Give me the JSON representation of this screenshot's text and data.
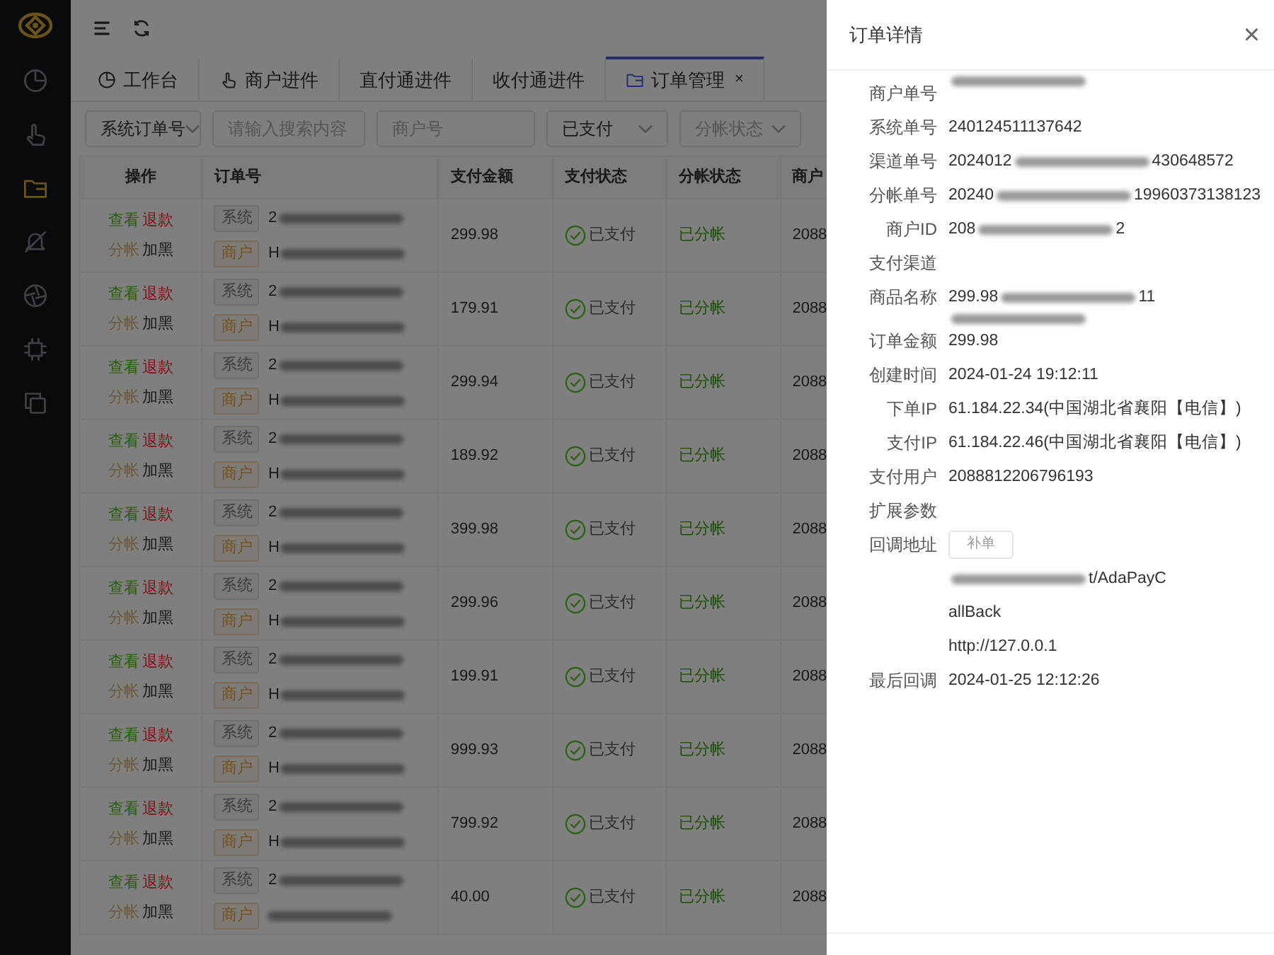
{
  "sidebar": {
    "items": [
      {
        "selected": false
      },
      {
        "selected": false
      },
      {
        "selected": true
      },
      {
        "selected": false
      },
      {
        "selected": false
      },
      {
        "selected": false
      },
      {
        "selected": false
      }
    ]
  },
  "tabs": [
    {
      "label": "工作台",
      "selected": false
    },
    {
      "label": "商户进件",
      "selected": false
    },
    {
      "label": "直付通进件",
      "selected": false
    },
    {
      "label": "收付通进件",
      "selected": false
    },
    {
      "label": "订单管理",
      "selected": true,
      "close": "×"
    }
  ],
  "filters": [
    {
      "kind": "select",
      "value": "系统订单号"
    },
    {
      "kind": "input",
      "placeholder": "请输入搜索内容"
    },
    {
      "kind": "input",
      "placeholder": "商户号"
    },
    {
      "kind": "select",
      "value": "已支付"
    },
    {
      "kind": "select",
      "placeholder": "分帐状态"
    }
  ],
  "table": {
    "columns": [
      "操作",
      "订单号",
      "支付金额",
      "支付状态",
      "分帐状态",
      "商户"
    ],
    "rows": [
      {
        "actions": [
          {
            "kind": "view",
            "label": "查看"
          },
          {
            "kind": "refund",
            "label": "退款"
          },
          {
            "kind": "split",
            "label": "分帐"
          },
          {
            "kind": "block",
            "label": "加黑"
          }
        ],
        "sys_tag": "系统",
        "sys_prefix": "2",
        "mer_tag": "商户",
        "mer_prefix": "H",
        "amount": "299.98",
        "pay_status": "已支付",
        "split_status": "已分帐",
        "merchant": "2088"
      },
      {
        "actions": [
          {
            "kind": "view",
            "label": "查看"
          },
          {
            "kind": "refund",
            "label": "退款"
          },
          {
            "kind": "split",
            "label": "分帐"
          },
          {
            "kind": "block",
            "label": "加黑"
          }
        ],
        "sys_tag": "系统",
        "sys_prefix": "2",
        "mer_tag": "商户",
        "mer_prefix": "H",
        "amount": "179.91",
        "pay_status": "已支付",
        "split_status": "已分帐",
        "merchant": "2088"
      },
      {
        "actions": [
          {
            "kind": "view",
            "label": "查看"
          },
          {
            "kind": "refund",
            "label": "退款"
          },
          {
            "kind": "split",
            "label": "分帐"
          },
          {
            "kind": "block",
            "label": "加黑"
          }
        ],
        "sys_tag": "系统",
        "sys_prefix": "2",
        "mer_tag": "商户",
        "mer_prefix": "H",
        "amount": "299.94",
        "pay_status": "已支付",
        "split_status": "已分帐",
        "merchant": "2088"
      },
      {
        "actions": [
          {
            "kind": "view",
            "label": "查看"
          },
          {
            "kind": "refund",
            "label": "退款"
          },
          {
            "kind": "split",
            "label": "分帐"
          },
          {
            "kind": "block",
            "label": "加黑"
          }
        ],
        "sys_tag": "系统",
        "sys_prefix": "2",
        "mer_tag": "商户",
        "mer_prefix": "H",
        "amount": "189.92",
        "pay_status": "已支付",
        "split_status": "已分帐",
        "merchant": "2088"
      },
      {
        "actions": [
          {
            "kind": "view",
            "label": "查看"
          },
          {
            "kind": "refund",
            "label": "退款"
          },
          {
            "kind": "split",
            "label": "分帐"
          },
          {
            "kind": "block",
            "label": "加黑"
          }
        ],
        "sys_tag": "系统",
        "sys_prefix": "2",
        "mer_tag": "商户",
        "mer_prefix": "H",
        "amount": "399.98",
        "pay_status": "已支付",
        "split_status": "已分帐",
        "merchant": "2088"
      },
      {
        "actions": [
          {
            "kind": "view",
            "label": "查看"
          },
          {
            "kind": "refund",
            "label": "退款"
          },
          {
            "kind": "split",
            "label": "分帐"
          },
          {
            "kind": "block",
            "label": "加黑"
          }
        ],
        "sys_tag": "系统",
        "sys_prefix": "2",
        "mer_tag": "商户",
        "mer_prefix": "H",
        "amount": "299.96",
        "pay_status": "已支付",
        "split_status": "已分帐",
        "merchant": "2088"
      },
      {
        "actions": [
          {
            "kind": "view",
            "label": "查看"
          },
          {
            "kind": "refund",
            "label": "退款"
          },
          {
            "kind": "split",
            "label": "分帐"
          },
          {
            "kind": "block",
            "label": "加黑"
          }
        ],
        "sys_tag": "系统",
        "sys_prefix": "2",
        "mer_tag": "商户",
        "mer_prefix": "H",
        "amount": "199.91",
        "pay_status": "已支付",
        "split_status": "已分帐",
        "merchant": "2088"
      },
      {
        "actions": [
          {
            "kind": "view",
            "label": "查看"
          },
          {
            "kind": "refund",
            "label": "退款"
          },
          {
            "kind": "split",
            "label": "分帐"
          },
          {
            "kind": "block",
            "label": "加黑"
          }
        ],
        "sys_tag": "系统",
        "sys_prefix": "2",
        "mer_tag": "商户",
        "mer_prefix": "H",
        "amount": "999.93",
        "pay_status": "已支付",
        "split_status": "已分帐",
        "merchant": "2088"
      },
      {
        "actions": [
          {
            "kind": "view",
            "label": "查看"
          },
          {
            "kind": "refund",
            "label": "退款"
          },
          {
            "kind": "split",
            "label": "分帐"
          },
          {
            "kind": "block",
            "label": "加黑"
          }
        ],
        "sys_tag": "系统",
        "sys_prefix": "2",
        "mer_tag": "商户",
        "mer_prefix": "H",
        "amount": "799.92",
        "pay_status": "已支付",
        "split_status": "已分帐",
        "merchant": "2088"
      },
      {
        "actions": [
          {
            "kind": "view",
            "label": "查看"
          },
          {
            "kind": "refund",
            "label": "退款"
          },
          {
            "kind": "split",
            "label": "分帐"
          },
          {
            "kind": "block",
            "label": "加黑"
          }
        ],
        "sys_tag": "系统",
        "sys_prefix": "2",
        "mer_tag": "商户",
        "amount": "40.00",
        "pay_status": "已支付",
        "split_status": "已分帐",
        "merchant": "2088"
      }
    ]
  },
  "drawer": {
    "title": "订单详情",
    "close": "×",
    "details": [
      {
        "label": "商户单号",
        "lines": [
          [
            {
              "kind": "blur"
            }
          ]
        ]
      },
      {
        "label": "系统单号",
        "lines": [
          [
            {
              "kind": "text",
              "text": "240124511137642"
            }
          ]
        ]
      },
      {
        "label": "渠道单号",
        "lines": [
          [
            {
              "kind": "text",
              "text": "2024012"
            },
            {
              "kind": "blur"
            },
            {
              "kind": "text",
              "text": "430648572"
            }
          ]
        ]
      },
      {
        "label": "分帐单号",
        "lines": [
          [
            {
              "kind": "text",
              "text": "20240"
            },
            {
              "kind": "blur"
            },
            {
              "kind": "text",
              "text": "19960373138123"
            }
          ]
        ]
      },
      {
        "label": "商户ID",
        "lines": [
          [
            {
              "kind": "text",
              "text": "208"
            },
            {
              "kind": "blur"
            },
            {
              "kind": "text",
              "text": "2"
            }
          ]
        ]
      },
      {
        "label": "支付渠道"
      },
      {
        "label": "商品名称",
        "lines": [
          [
            {
              "kind": "text",
              "text": "299.98"
            },
            {
              "kind": "blur"
            },
            {
              "kind": "text",
              "text": "11"
            }
          ],
          [
            {
              "kind": "blur"
            }
          ]
        ]
      },
      {
        "label": "订单金额",
        "lines": [
          [
            {
              "kind": "text",
              "text": "299.98"
            }
          ]
        ]
      },
      {
        "label": "创建时间",
        "lines": [
          [
            {
              "kind": "text",
              "text": "2024-01-24 19:12:11"
            }
          ]
        ]
      },
      {
        "label": "下单IP",
        "lines": [
          [
            {
              "kind": "text",
              "text": "61.184.22.34(中国湖北省襄阳【电信】)"
            }
          ]
        ]
      },
      {
        "label": "支付IP",
        "lines": [
          [
            {
              "kind": "text",
              "text": "61.184.22.46(中国湖北省襄阳【电信】)"
            }
          ]
        ]
      },
      {
        "label": "支付用户",
        "lines": [
          [
            {
              "kind": "text",
              "text": "2088812206796193"
            }
          ]
        ]
      },
      {
        "label": "扩展参数"
      },
      {
        "label": "回调地址",
        "lines": [
          [
            {
              "kind": "button",
              "text": "补单"
            }
          ],
          [
            {
              "kind": "blur"
            },
            {
              "kind": "text",
              "text": "t/AdaPayC"
            }
          ],
          [
            {
              "kind": "text",
              "text": "allBack"
            }
          ],
          [
            {
              "kind": "text",
              "text": "http://127.0.0.1"
            }
          ]
        ]
      },
      {
        "label": "最后回调",
        "lines": [
          [
            {
              "kind": "text",
              "text": "2024-01-25 12:12:26"
            }
          ]
        ]
      }
    ]
  }
}
